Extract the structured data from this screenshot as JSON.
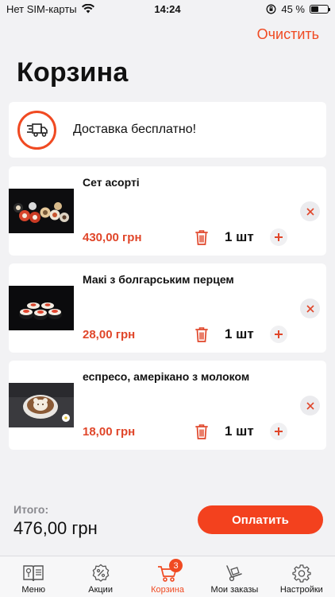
{
  "status_bar": {
    "carrier": "Нет SIM-карты",
    "time": "14:24",
    "battery": "45 %",
    "battery_level": 0.45
  },
  "header": {
    "clear_label": "Очистить",
    "title": "Корзина"
  },
  "delivery": {
    "text": "Доставка бесплатно!",
    "icon": "delivery-truck-icon"
  },
  "items": [
    {
      "name": "Сет асорті",
      "price": "430,00 грн",
      "qty": "1 шт",
      "image": "sushi-set-image"
    },
    {
      "name": "Макі з болгарським перцем",
      "price": "28,00 грн",
      "qty": "1 шт",
      "image": "maki-roll-image"
    },
    {
      "name": "еспресо, амерікано з молоком",
      "price": "18,00 грн",
      "qty": "1 шт",
      "image": "latte-art-image"
    }
  ],
  "summary": {
    "total_label": "Итого:",
    "total_value": "476,00 грн",
    "pay_label": "Оплатить"
  },
  "tabs": [
    {
      "label": "Меню",
      "icon": "menu-book-icon"
    },
    {
      "label": "Акции",
      "icon": "discount-badge-icon"
    },
    {
      "label": "Корзина",
      "icon": "cart-icon",
      "badge": "3",
      "active": true
    },
    {
      "label": "Мои заказы",
      "icon": "hand-truck-icon"
    },
    {
      "label": "Настройки",
      "icon": "gear-icon"
    }
  ],
  "colors": {
    "accent": "#f04a22",
    "price": "#e0462a",
    "background": "#f2f2f4"
  }
}
